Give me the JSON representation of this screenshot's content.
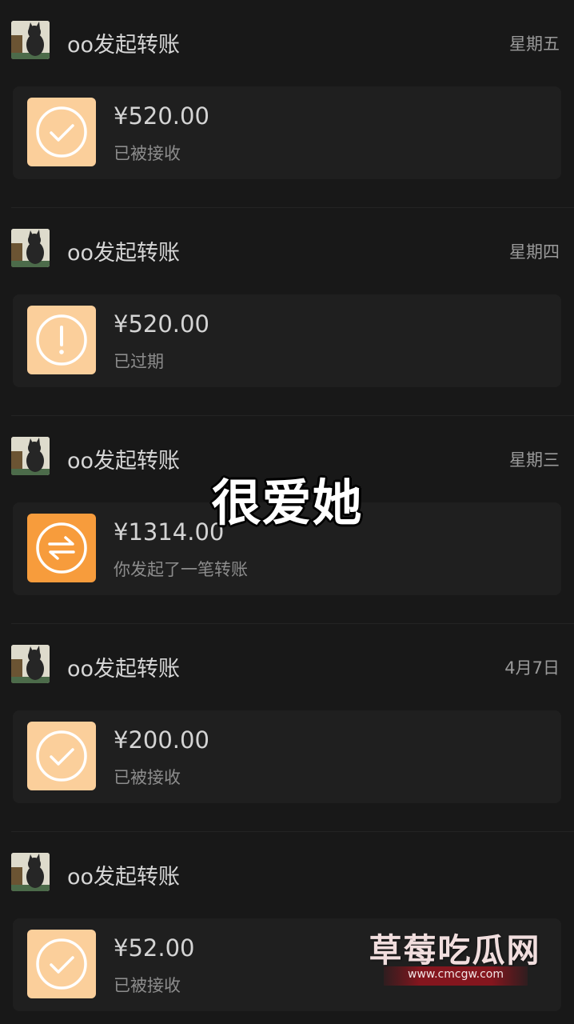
{
  "transfers": [
    {
      "sender": "oo发起转账",
      "date": "星期五",
      "amount": "¥520.00",
      "status": "已被接收",
      "status_icon": "checkmark-circle-icon"
    },
    {
      "sender": "oo发起转账",
      "date": "星期四",
      "amount": "¥520.00",
      "status": "已过期",
      "status_icon": "exclamation-circle-icon"
    },
    {
      "sender": "oo发起转账",
      "date": "星期三",
      "amount": "¥1314.00",
      "status": "你发起了一笔转账",
      "status_icon": "transfer-arrows-icon"
    },
    {
      "sender": "oo发起转账",
      "date": "4月7日",
      "amount": "¥200.00",
      "status": "已被接收",
      "status_icon": "checkmark-circle-icon"
    },
    {
      "sender": "oo发起转账",
      "date": "",
      "amount": "¥52.00",
      "status": "已被接收",
      "status_icon": "checkmark-circle-icon"
    }
  ],
  "overlay_caption": "很爱她",
  "watermark": {
    "title": "草莓吃瓜网",
    "url": "www.cmcgw.com"
  },
  "colors": {
    "background": "#181818",
    "card": "#1f1f1f",
    "received_icon": "#fbcf9b",
    "pending_icon": "#f79c3c"
  }
}
